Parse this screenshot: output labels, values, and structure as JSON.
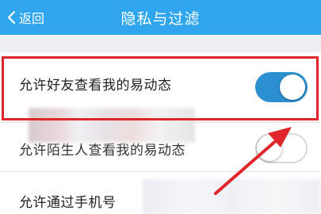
{
  "header": {
    "back_label": "返回",
    "title": "隐私与过滤"
  },
  "settings": [
    {
      "label": "允许好友查看我的易动态",
      "enabled": true
    },
    {
      "label": "允许陌生人查看我的易动态",
      "enabled": false
    },
    {
      "label": "允许通过手机号"
    }
  ],
  "colors": {
    "header": "#2fa6ee",
    "toggle_on": "#2b8fd0",
    "highlight": "#e0262a"
  },
  "icons": {
    "back": "chevron-left-icon",
    "pointer": "red-arrow-annotation"
  }
}
